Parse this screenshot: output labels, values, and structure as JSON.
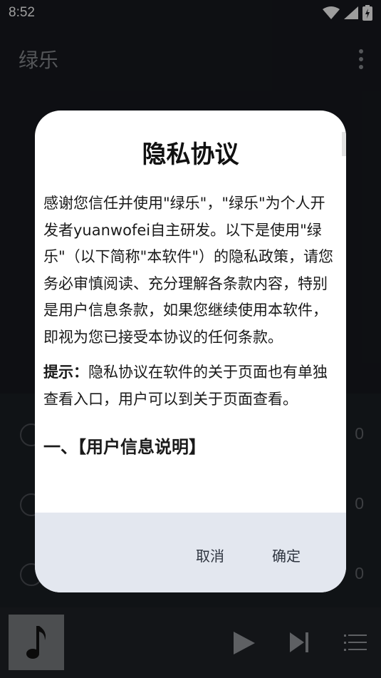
{
  "status_bar": {
    "time": "8:52"
  },
  "toolbar": {
    "title": "绿乐"
  },
  "stats": [
    {
      "icon": "music-note-icon",
      "count": "0"
    },
    {
      "icon": "heart-icon",
      "count": "0"
    },
    {
      "icon": "list-icon",
      "count": "0"
    }
  ],
  "dialog": {
    "title": "隐私协议",
    "paragraph1": "感谢您信任并使用\"绿乐\"，\"绿乐\"为个人开发者yuanwofei自主研发。以下是使用\"绿乐\"（以下简称\"本软件\"）的隐私政策，请您务必审慎阅读、充分理解各条款内容，特别是用户信息条款，如果您继续使用本软件，即视为您已接受本协议的任何条款。",
    "tip_label": "提示：",
    "tip_text": "隐私协议在软件的关于页面也有单独查看入口，用户可以到关于页面查看。",
    "section1_heading": "一、【用户信息说明】",
    "cancel_label": "取消",
    "confirm_label": "确定"
  },
  "colors": {
    "app_bg": "#15171c",
    "dialog_bg": "#ffffff",
    "actions_bg": "#e3e7ef"
  }
}
